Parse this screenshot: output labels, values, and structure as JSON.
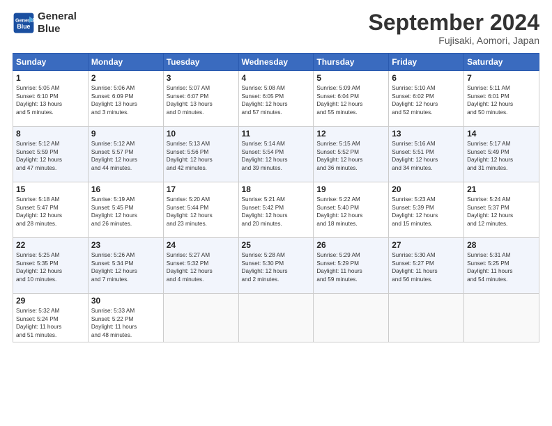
{
  "header": {
    "logo_line1": "General",
    "logo_line2": "Blue",
    "month": "September 2024",
    "location": "Fujisaki, Aomori, Japan"
  },
  "days_of_week": [
    "Sunday",
    "Monday",
    "Tuesday",
    "Wednesday",
    "Thursday",
    "Friday",
    "Saturday"
  ],
  "weeks": [
    [
      {
        "num": "1",
        "detail": "Sunrise: 5:05 AM\nSunset: 6:10 PM\nDaylight: 13 hours\nand 5 minutes."
      },
      {
        "num": "2",
        "detail": "Sunrise: 5:06 AM\nSunset: 6:09 PM\nDaylight: 13 hours\nand 3 minutes."
      },
      {
        "num": "3",
        "detail": "Sunrise: 5:07 AM\nSunset: 6:07 PM\nDaylight: 13 hours\nand 0 minutes."
      },
      {
        "num": "4",
        "detail": "Sunrise: 5:08 AM\nSunset: 6:05 PM\nDaylight: 12 hours\nand 57 minutes."
      },
      {
        "num": "5",
        "detail": "Sunrise: 5:09 AM\nSunset: 6:04 PM\nDaylight: 12 hours\nand 55 minutes."
      },
      {
        "num": "6",
        "detail": "Sunrise: 5:10 AM\nSunset: 6:02 PM\nDaylight: 12 hours\nand 52 minutes."
      },
      {
        "num": "7",
        "detail": "Sunrise: 5:11 AM\nSunset: 6:01 PM\nDaylight: 12 hours\nand 50 minutes."
      }
    ],
    [
      {
        "num": "8",
        "detail": "Sunrise: 5:12 AM\nSunset: 5:59 PM\nDaylight: 12 hours\nand 47 minutes."
      },
      {
        "num": "9",
        "detail": "Sunrise: 5:12 AM\nSunset: 5:57 PM\nDaylight: 12 hours\nand 44 minutes."
      },
      {
        "num": "10",
        "detail": "Sunrise: 5:13 AM\nSunset: 5:56 PM\nDaylight: 12 hours\nand 42 minutes."
      },
      {
        "num": "11",
        "detail": "Sunrise: 5:14 AM\nSunset: 5:54 PM\nDaylight: 12 hours\nand 39 minutes."
      },
      {
        "num": "12",
        "detail": "Sunrise: 5:15 AM\nSunset: 5:52 PM\nDaylight: 12 hours\nand 36 minutes."
      },
      {
        "num": "13",
        "detail": "Sunrise: 5:16 AM\nSunset: 5:51 PM\nDaylight: 12 hours\nand 34 minutes."
      },
      {
        "num": "14",
        "detail": "Sunrise: 5:17 AM\nSunset: 5:49 PM\nDaylight: 12 hours\nand 31 minutes."
      }
    ],
    [
      {
        "num": "15",
        "detail": "Sunrise: 5:18 AM\nSunset: 5:47 PM\nDaylight: 12 hours\nand 28 minutes."
      },
      {
        "num": "16",
        "detail": "Sunrise: 5:19 AM\nSunset: 5:45 PM\nDaylight: 12 hours\nand 26 minutes."
      },
      {
        "num": "17",
        "detail": "Sunrise: 5:20 AM\nSunset: 5:44 PM\nDaylight: 12 hours\nand 23 minutes."
      },
      {
        "num": "18",
        "detail": "Sunrise: 5:21 AM\nSunset: 5:42 PM\nDaylight: 12 hours\nand 20 minutes."
      },
      {
        "num": "19",
        "detail": "Sunrise: 5:22 AM\nSunset: 5:40 PM\nDaylight: 12 hours\nand 18 minutes."
      },
      {
        "num": "20",
        "detail": "Sunrise: 5:23 AM\nSunset: 5:39 PM\nDaylight: 12 hours\nand 15 minutes."
      },
      {
        "num": "21",
        "detail": "Sunrise: 5:24 AM\nSunset: 5:37 PM\nDaylight: 12 hours\nand 12 minutes."
      }
    ],
    [
      {
        "num": "22",
        "detail": "Sunrise: 5:25 AM\nSunset: 5:35 PM\nDaylight: 12 hours\nand 10 minutes."
      },
      {
        "num": "23",
        "detail": "Sunrise: 5:26 AM\nSunset: 5:34 PM\nDaylight: 12 hours\nand 7 minutes."
      },
      {
        "num": "24",
        "detail": "Sunrise: 5:27 AM\nSunset: 5:32 PM\nDaylight: 12 hours\nand 4 minutes."
      },
      {
        "num": "25",
        "detail": "Sunrise: 5:28 AM\nSunset: 5:30 PM\nDaylight: 12 hours\nand 2 minutes."
      },
      {
        "num": "26",
        "detail": "Sunrise: 5:29 AM\nSunset: 5:29 PM\nDaylight: 11 hours\nand 59 minutes."
      },
      {
        "num": "27",
        "detail": "Sunrise: 5:30 AM\nSunset: 5:27 PM\nDaylight: 11 hours\nand 56 minutes."
      },
      {
        "num": "28",
        "detail": "Sunrise: 5:31 AM\nSunset: 5:25 PM\nDaylight: 11 hours\nand 54 minutes."
      }
    ],
    [
      {
        "num": "29",
        "detail": "Sunrise: 5:32 AM\nSunset: 5:24 PM\nDaylight: 11 hours\nand 51 minutes."
      },
      {
        "num": "30",
        "detail": "Sunrise: 5:33 AM\nSunset: 5:22 PM\nDaylight: 11 hours\nand 48 minutes."
      },
      {
        "num": "",
        "detail": ""
      },
      {
        "num": "",
        "detail": ""
      },
      {
        "num": "",
        "detail": ""
      },
      {
        "num": "",
        "detail": ""
      },
      {
        "num": "",
        "detail": ""
      }
    ]
  ]
}
